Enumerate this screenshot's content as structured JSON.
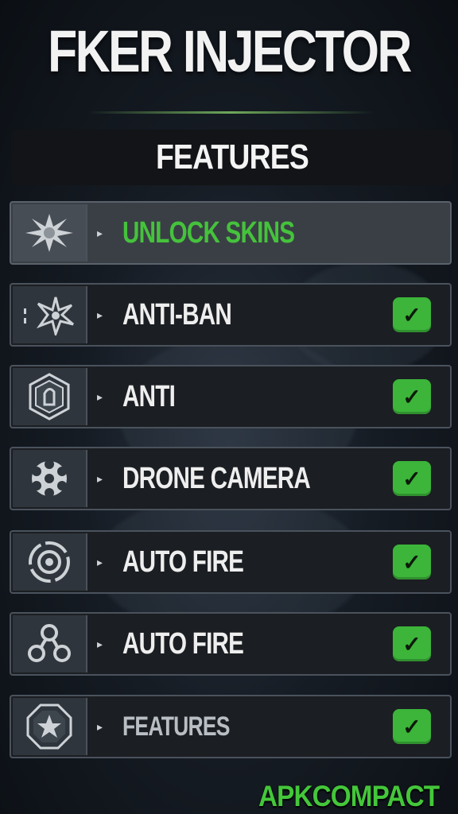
{
  "title": "FKER INJECTOR",
  "section_header": "FEATURES",
  "rows": [
    {
      "label": "UNLOCK SKINS",
      "icon": "splat-icon",
      "checked": false
    },
    {
      "label": "ANTI-BAN",
      "icon": "shuriken-icon",
      "checked": true
    },
    {
      "label": "ANTI",
      "icon": "shield-badge-icon",
      "checked": true
    },
    {
      "label": "DRONE CAMERA",
      "icon": "snowflake-icon",
      "checked": true
    },
    {
      "label": "AUTO FIRE",
      "icon": "target-ring-icon",
      "checked": true
    },
    {
      "label": "AUTO FIRE",
      "icon": "trefoil-icon",
      "checked": true
    },
    {
      "label": "FEATURES",
      "icon": "octagon-emblem-icon",
      "checked": true
    }
  ],
  "checkmark_glyph": "✓",
  "arrow_glyph": "▸",
  "watermark": "APKCOMPACT",
  "colors": {
    "accent_green": "#45c23c",
    "checkbox_green": "#3cb53a",
    "row_bg": "#1b1e22",
    "row_border": "#4a525c"
  }
}
